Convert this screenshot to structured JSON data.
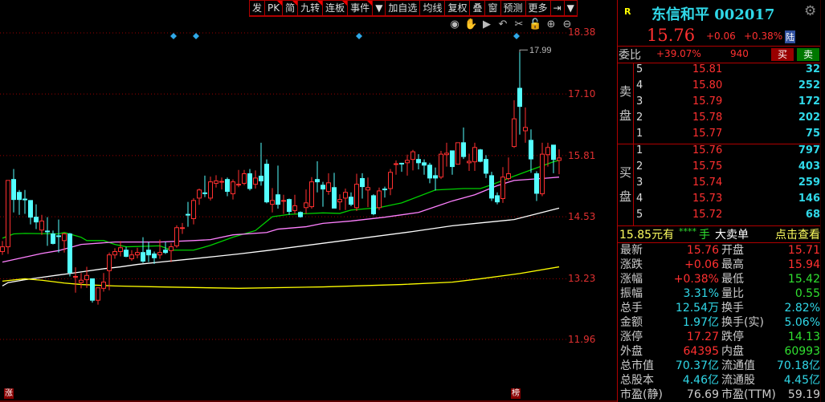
{
  "toolbar": {
    "buttons": [
      "发",
      "PK",
      "简",
      "九转",
      "连板",
      "事件",
      "▼",
      "加自选",
      "均线",
      "复权",
      "叠",
      "窗",
      "预测",
      "更多",
      "⇥",
      "▼"
    ],
    "flags": [
      false,
      true,
      true,
      true,
      true,
      true,
      false,
      false,
      false,
      false,
      false,
      false,
      false,
      false,
      false,
      false
    ]
  },
  "chart_tools": [
    "eye-icon",
    "hand-icon",
    "play-icon",
    "undo-icon",
    "scissors-icon",
    "lock-icon",
    "zoom-in-icon",
    "zoom-out-icon"
  ],
  "price_axis": [
    "18.38",
    "17.10",
    "15.81",
    "14.53",
    "13.23",
    "11.96"
  ],
  "high_marker": "17.99",
  "bottom_markers": {
    "left": "涨",
    "right": "榜"
  },
  "colors": {
    "up": "#ff3030",
    "down": "#54ffff",
    "ma1": "#00d000",
    "ma2": "#ff80ff",
    "ma3": "#ffffff",
    "ma4": "#ffff00",
    "diamond": "#30a8e8"
  },
  "chart_data": {
    "type": "candlestick",
    "ylim": [
      11.96,
      18.38
    ],
    "ohlc": [
      [
        13.8,
        14.02,
        13.73,
        13.9
      ],
      [
        13.9,
        15.29,
        13.75,
        15.29
      ],
      [
        15.31,
        15.53,
        14.62,
        14.89
      ],
      [
        15.04,
        15.09,
        14.57,
        14.89
      ],
      [
        14.9,
        15.09,
        14.59,
        14.89
      ],
      [
        14.87,
        14.87,
        14.37,
        14.52
      ],
      [
        14.52,
        14.79,
        14.27,
        14.42
      ],
      [
        14.25,
        14.57,
        14.15,
        14.44
      ],
      [
        14.23,
        14.52,
        13.92,
        14.22
      ],
      [
        14.17,
        14.24,
        13.95,
        13.97
      ],
      [
        14.13,
        14.47,
        13.78,
        14.12
      ],
      [
        14.03,
        14.19,
        13.78,
        14.17
      ],
      [
        14.17,
        14.19,
        13.28,
        13.36
      ],
      [
        13.27,
        13.47,
        12.94,
        13.28
      ],
      [
        13.15,
        13.35,
        13.03,
        13.2
      ],
      [
        13.21,
        13.48,
        13.04,
        13.3
      ],
      [
        13.23,
        13.23,
        12.73,
        12.78
      ],
      [
        12.78,
        13.04,
        12.69,
        13.04
      ],
      [
        13.03,
        13.35,
        12.96,
        13.16
      ],
      [
        13.4,
        13.78,
        12.99,
        13.73
      ],
      [
        13.73,
        13.87,
        13.65,
        13.8
      ],
      [
        13.8,
        14.02,
        13.7,
        13.88
      ],
      [
        13.83,
        13.9,
        13.68,
        13.7
      ],
      [
        13.65,
        13.83,
        13.61,
        13.73
      ],
      [
        13.73,
        13.88,
        13.66,
        13.78
      ],
      [
        13.78,
        14.1,
        13.56,
        13.6
      ],
      [
        13.83,
        14.0,
        13.58,
        13.73
      ],
      [
        13.75,
        13.8,
        13.54,
        13.67
      ],
      [
        13.73,
        14.05,
        13.65,
        13.78
      ],
      [
        13.83,
        14.0,
        13.75,
        13.78
      ],
      [
        13.82,
        13.98,
        13.58,
        13.9
      ],
      [
        13.92,
        14.35,
        13.88,
        14.3
      ],
      [
        14.29,
        14.4,
        14.17,
        14.3
      ],
      [
        14.58,
        14.84,
        14.32,
        14.57
      ],
      [
        14.49,
        14.92,
        14.37,
        14.87
      ],
      [
        14.92,
        15.12,
        14.78,
        15.09
      ],
      [
        15.03,
        15.39,
        14.94,
        15.02
      ],
      [
        14.92,
        15.37,
        14.87,
        15.26
      ],
      [
        15.23,
        15.4,
        15.14,
        15.28
      ],
      [
        15.26,
        15.35,
        15.1,
        15.27
      ],
      [
        15.31,
        15.35,
        14.96,
        15.06
      ],
      [
        15.01,
        15.31,
        14.89,
        15.26
      ],
      [
        15.2,
        15.51,
        15.15,
        15.21
      ],
      [
        15.23,
        15.51,
        15.19,
        15.43
      ],
      [
        15.43,
        15.53,
        15.08,
        15.12
      ],
      [
        15.21,
        15.5,
        15.12,
        15.34
      ],
      [
        15.38,
        16.08,
        15.18,
        15.28
      ],
      [
        15.63,
        15.73,
        14.81,
        14.84
      ],
      [
        14.79,
        15.13,
        14.62,
        14.87
      ],
      [
        14.99,
        15.6,
        14.7,
        14.79
      ],
      [
        14.86,
        14.99,
        14.59,
        14.87
      ],
      [
        14.89,
        14.91,
        14.57,
        14.64
      ],
      [
        14.66,
        14.99,
        14.59,
        14.76
      ],
      [
        14.62,
        14.64,
        14.51,
        14.53
      ],
      [
        14.72,
        15.1,
        14.59,
        14.82
      ],
      [
        14.74,
        15.36,
        14.7,
        15.26
      ],
      [
        15.31,
        15.69,
        15.04,
        15.26
      ],
      [
        15.19,
        15.26,
        14.74,
        15.11
      ],
      [
        15.06,
        15.44,
        14.99,
        15.24
      ],
      [
        15.14,
        15.45,
        14.71,
        14.71
      ],
      [
        14.84,
        15.0,
        14.67,
        14.89
      ],
      [
        14.92,
        15.12,
        14.67,
        15.04
      ],
      [
        14.94,
        15.04,
        14.75,
        14.79
      ],
      [
        14.72,
        15.43,
        14.65,
        15.21
      ],
      [
        15.33,
        15.44,
        14.91,
        15.16
      ],
      [
        15.09,
        15.35,
        14.73,
        15.14
      ],
      [
        14.97,
        15.0,
        14.56,
        14.59
      ],
      [
        14.72,
        15.14,
        14.67,
        15.07
      ],
      [
        15.11,
        15.16,
        14.93,
        15.1
      ],
      [
        15.12,
        15.53,
        14.98,
        15.46
      ],
      [
        15.63,
        15.71,
        15.41,
        15.64
      ],
      [
        15.65,
        15.66,
        15.47,
        15.64
      ],
      [
        15.66,
        15.83,
        15.39,
        15.71
      ],
      [
        15.73,
        15.93,
        15.5,
        15.89
      ],
      [
        15.73,
        15.84,
        15.52,
        15.66
      ],
      [
        15.66,
        15.73,
        15.41,
        15.61
      ],
      [
        15.61,
        15.66,
        15.23,
        15.34
      ],
      [
        15.39,
        15.56,
        15.08,
        15.34
      ],
      [
        15.36,
        15.91,
        15.32,
        15.84
      ],
      [
        15.83,
        16.08,
        15.58,
        15.86
      ],
      [
        15.91,
        15.91,
        15.41,
        15.58
      ],
      [
        15.63,
        16.08,
        15.63,
        16.08
      ],
      [
        16.08,
        16.4,
        15.74,
        15.79
      ],
      [
        15.66,
        15.85,
        15.49,
        15.69
      ],
      [
        15.68,
        16.08,
        15.49,
        15.98
      ],
      [
        15.93,
        15.95,
        15.67,
        15.69
      ],
      [
        15.73,
        15.82,
        15.34,
        15.44
      ],
      [
        15.39,
        15.47,
        14.86,
        14.92
      ],
      [
        14.97,
        15.04,
        14.79,
        14.84
      ],
      [
        14.91,
        15.57,
        14.82,
        15.36
      ],
      [
        15.33,
        15.77,
        15.29,
        15.43
      ],
      [
        16.0,
        16.97,
        15.97,
        16.58
      ],
      [
        17.22,
        17.99,
        16.25,
        16.84
      ],
      [
        16.33,
        16.82,
        16.08,
        16.4
      ],
      [
        16.13,
        16.36,
        15.45,
        15.74
      ],
      [
        15.43,
        15.48,
        14.86,
        15.02
      ],
      [
        15.01,
        16.08,
        14.96,
        15.84
      ],
      [
        15.83,
        16.08,
        15.58,
        15.98
      ],
      [
        16.03,
        16.03,
        15.44,
        15.73
      ],
      [
        15.71,
        15.94,
        15.42,
        15.76
      ]
    ],
    "ma": [
      {
        "color": "#00d000",
        "points": [
          [
            0,
            14.08
          ],
          [
            2,
            14.17
          ],
          [
            4,
            14.18
          ],
          [
            10,
            14.17
          ],
          [
            11,
            14.2
          ],
          [
            14,
            14.1
          ],
          [
            15,
            14.03
          ],
          [
            18,
            14.03
          ],
          [
            20,
            13.95
          ],
          [
            22,
            13.9
          ],
          [
            28,
            13.92
          ],
          [
            30,
            13.83
          ],
          [
            34,
            13.83
          ],
          [
            37,
            13.93
          ],
          [
            41,
            14.1
          ],
          [
            45,
            14.24
          ],
          [
            48,
            14.53
          ],
          [
            51,
            14.58
          ],
          [
            57,
            14.61
          ],
          [
            60,
            14.6
          ],
          [
            62,
            14.67
          ],
          [
            67,
            14.72
          ],
          [
            71,
            14.82
          ],
          [
            77,
            15.09
          ],
          [
            82,
            15.12
          ],
          [
            85,
            15.12
          ],
          [
            87,
            15.2
          ],
          [
            91,
            15.38
          ],
          [
            94,
            15.51
          ],
          [
            98,
            15.68
          ],
          [
            99,
            15.71
          ]
        ]
      },
      {
        "color": "#ff80ff",
        "points": [
          [
            0,
            13.58
          ],
          [
            7,
            13.76
          ],
          [
            10,
            13.82
          ],
          [
            14,
            13.95
          ],
          [
            20,
            14.0
          ],
          [
            28,
            14.0
          ],
          [
            34,
            14.03
          ],
          [
            37,
            14.05
          ],
          [
            41,
            14.15
          ],
          [
            47,
            14.2
          ],
          [
            49,
            14.27
          ],
          [
            54,
            14.32
          ],
          [
            57,
            14.39
          ],
          [
            62,
            14.44
          ],
          [
            68,
            14.52
          ],
          [
            74,
            14.62
          ],
          [
            80,
            14.86
          ],
          [
            84,
            14.99
          ],
          [
            88,
            15.18
          ],
          [
            91,
            15.29
          ],
          [
            97,
            15.34
          ],
          [
            99,
            15.36
          ]
        ]
      },
      {
        "color": "#ffffff",
        "points": [
          [
            0,
            13.08
          ],
          [
            1,
            13.15
          ],
          [
            4,
            13.21
          ],
          [
            7,
            13.26
          ],
          [
            10,
            13.31
          ],
          [
            12,
            13.34
          ],
          [
            15,
            13.39
          ],
          [
            18,
            13.44
          ],
          [
            21,
            13.48
          ],
          [
            24,
            13.53
          ],
          [
            28,
            13.58
          ],
          [
            34,
            13.65
          ],
          [
            38,
            13.7
          ],
          [
            42,
            13.75
          ],
          [
            47,
            13.82
          ],
          [
            60,
            14.02
          ],
          [
            73,
            14.22
          ],
          [
            80,
            14.34
          ],
          [
            85,
            14.4
          ],
          [
            91,
            14.47
          ],
          [
            99,
            14.71
          ]
        ]
      },
      {
        "color": "#ffff00",
        "points": [
          [
            0,
            13.18
          ],
          [
            4,
            13.23
          ],
          [
            7,
            13.2
          ],
          [
            11,
            13.14
          ],
          [
            14,
            13.11
          ],
          [
            20,
            13.08
          ],
          [
            28,
            13.06
          ],
          [
            42,
            13.03
          ],
          [
            57,
            13.06
          ],
          [
            71,
            13.11
          ],
          [
            80,
            13.16
          ],
          [
            85,
            13.23
          ],
          [
            92,
            13.34
          ],
          [
            99,
            13.48
          ]
        ]
      }
    ],
    "event_markers_at_index": [
      30,
      34,
      63,
      91
    ]
  },
  "quote": {
    "flag": "R",
    "name": "东信和平 002017",
    "price": "15.76",
    "change": "+0.06",
    "pct": "+0.38%",
    "market": "陆",
    "weibi_label": "委比",
    "weibi": "+39.07%",
    "weicha": "940",
    "buy_btn": "买",
    "sell_btn": "卖",
    "sell_label": [
      "卖",
      "盘"
    ],
    "buy_label": [
      "买",
      "盘"
    ],
    "sells": [
      {
        "lv": "5",
        "p": "15.81",
        "v": "32"
      },
      {
        "lv": "4",
        "p": "15.80",
        "v": "252"
      },
      {
        "lv": "3",
        "p": "15.79",
        "v": "172"
      },
      {
        "lv": "2",
        "p": "15.78",
        "v": "202"
      },
      {
        "lv": "1",
        "p": "15.77",
        "v": "75"
      }
    ],
    "buys": [
      {
        "lv": "1",
        "p": "15.76",
        "v": "797"
      },
      {
        "lv": "2",
        "p": "15.75",
        "v": "403"
      },
      {
        "lv": "3",
        "p": "15.74",
        "v": "259"
      },
      {
        "lv": "4",
        "p": "15.73",
        "v": "146"
      },
      {
        "lv": "5",
        "p": "15.72",
        "v": "68"
      }
    ],
    "big_order": {
      "price": "15.85元有",
      "stars": "****",
      "unit": "手",
      "type": "大卖单",
      "link": "点击查看"
    },
    "stats": [
      {
        "l1": "最新",
        "v1": "15.76",
        "c1": "red",
        "l2": "开盘",
        "v2": "15.71",
        "c2": "red"
      },
      {
        "l1": "涨跌",
        "v1": "+0.06",
        "c1": "red",
        "l2": "最高",
        "v2": "15.94",
        "c2": "red"
      },
      {
        "l1": "涨幅",
        "v1": "+0.38%",
        "c1": "red",
        "l2": "最低",
        "v2": "15.42",
        "c2": "green"
      },
      {
        "l1": "振幅",
        "v1": "3.31%",
        "c1": "cyan",
        "l2": "量比",
        "v2": "0.55",
        "c2": "green"
      },
      {
        "l1": "总手",
        "v1": "12.54万",
        "c1": "cyan",
        "l2": "换手",
        "v2": "2.82%",
        "c2": "cyan"
      },
      {
        "l1": "金额",
        "v1": "1.97亿",
        "c1": "cyan",
        "l2": "换手(实)",
        "v2": "5.06%",
        "c2": "cyan"
      },
      {
        "l1": "涨停",
        "v1": "17.27",
        "c1": "red",
        "l2": "跌停",
        "v2": "14.13",
        "c2": "green"
      },
      {
        "l1": "外盘",
        "v1": "64395",
        "c1": "red",
        "l2": "内盘",
        "v2": "60993",
        "c2": "green"
      },
      {
        "l1": "总市值",
        "v1": "70.37亿",
        "c1": "cyan",
        "l2": "流通值",
        "v2": "70.18亿",
        "c2": "cyan"
      },
      {
        "l1": "总股本",
        "v1": "4.46亿",
        "c1": "cyan",
        "l2": "流通股",
        "v2": "4.45亿",
        "c2": "cyan"
      },
      {
        "l1": "市盈(静)",
        "v1": "76.69",
        "c1": "grey",
        "l2": "市盈(TTM)",
        "v2": "59.19",
        "c2": "grey"
      }
    ]
  }
}
